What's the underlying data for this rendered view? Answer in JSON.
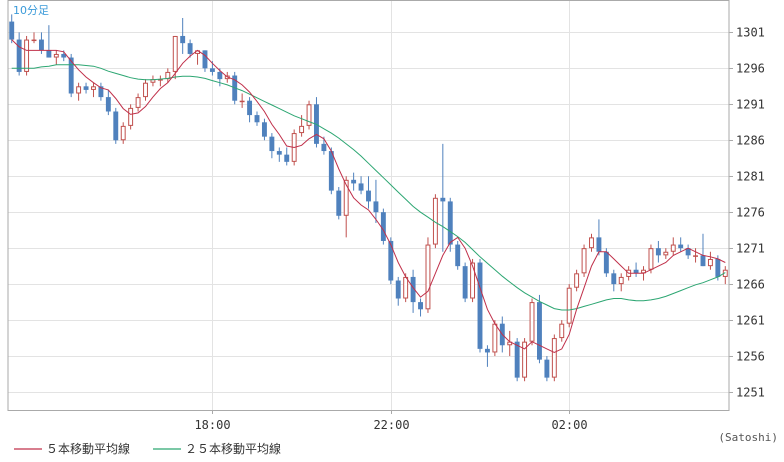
{
  "chart_data": {
    "type": "candlestick",
    "title": "10分足",
    "credit": "(Satoshi)",
    "y_ticks": [
      1301,
      1296,
      1291,
      1286,
      1281,
      1276,
      1271,
      1266,
      1261,
      1256,
      1251
    ],
    "ylim": [
      1248.5,
      1305.5
    ],
    "x_ticks": [
      {
        "label": "18:00",
        "index": 27
      },
      {
        "label": "22:00",
        "index": 51
      },
      {
        "label": "02:00",
        "index": 75
      }
    ],
    "x_count": 97,
    "grid": true,
    "colors": {
      "up": "#c0504d",
      "down": "#4f81bd",
      "ma5": "#c0304a",
      "ma25": "#2ca672",
      "grid": "#e3e3e3",
      "frame": "#aaaaaa",
      "title": "#3a9ad9"
    },
    "legend": [
      {
        "label": "５本移動平均線",
        "color": "#c0304a"
      },
      {
        "label": "２５本移動平均線",
        "color": "#2ca672"
      }
    ],
    "candles": [
      [
        1302.5,
        1303.5,
        1299.5,
        1300.0
      ],
      [
        1300.0,
        1301.0,
        1295.0,
        1295.5
      ],
      [
        1295.5,
        1300.5,
        1295.0,
        1300.0
      ],
      [
        1300.0,
        1301.0,
        1299.5,
        1300.0
      ],
      [
        1300.0,
        1301.0,
        1298.0,
        1298.5
      ],
      [
        1298.5,
        1302.0,
        1297.5,
        1297.5
      ],
      [
        1297.5,
        1298.5,
        1296.5,
        1298.0
      ],
      [
        1298.0,
        1298.5,
        1297.0,
        1297.5
      ],
      [
        1297.5,
        1298.0,
        1292.0,
        1292.5
      ],
      [
        1292.5,
        1294.0,
        1291.5,
        1293.5
      ],
      [
        1293.5,
        1294.0,
        1292.5,
        1293.0
      ],
      [
        1293.0,
        1294.0,
        1292.0,
        1293.5
      ],
      [
        1293.5,
        1294.0,
        1291.5,
        1292.0
      ],
      [
        1292.0,
        1293.0,
        1289.5,
        1290.0
      ],
      [
        1290.0,
        1290.5,
        1285.5,
        1286.0
      ],
      [
        1286.0,
        1288.5,
        1285.5,
        1288.0
      ],
      [
        1288.0,
        1291.0,
        1287.5,
        1290.5
      ],
      [
        1290.5,
        1292.5,
        1290.0,
        1292.0
      ],
      [
        1292.0,
        1294.5,
        1291.5,
        1294.0
      ],
      [
        1294.0,
        1295.0,
        1293.5,
        1294.5
      ],
      [
        1294.5,
        1295.0,
        1293.5,
        1294.5
      ],
      [
        1294.5,
        1296.0,
        1294.0,
        1295.5
      ],
      [
        1295.5,
        1300.5,
        1294.5,
        1300.5
      ],
      [
        1300.5,
        1303.0,
        1298.0,
        1299.5
      ],
      [
        1299.5,
        1300.0,
        1297.5,
        1298.0
      ],
      [
        1298.0,
        1298.5,
        1296.5,
        1298.5
      ],
      [
        1298.5,
        1298.5,
        1295.5,
        1296.0
      ],
      [
        1296.0,
        1297.0,
        1295.0,
        1295.5
      ],
      [
        1295.5,
        1296.0,
        1293.5,
        1294.5
      ],
      [
        1294.5,
        1295.5,
        1294.0,
        1295.0
      ],
      [
        1295.0,
        1295.5,
        1291.0,
        1291.5
      ],
      [
        1291.5,
        1292.5,
        1290.5,
        1291.5
      ],
      [
        1291.5,
        1292.0,
        1288.5,
        1289.5
      ],
      [
        1289.5,
        1290.0,
        1288.0,
        1288.5
      ],
      [
        1288.5,
        1289.0,
        1286.0,
        1286.5
      ],
      [
        1286.5,
        1287.0,
        1283.5,
        1284.5
      ],
      [
        1284.5,
        1285.0,
        1283.0,
        1284.0
      ],
      [
        1284.0,
        1285.0,
        1282.5,
        1283.0
      ],
      [
        1283.0,
        1287.5,
        1282.5,
        1287.0
      ],
      [
        1287.0,
        1289.5,
        1286.5,
        1288.0
      ],
      [
        1288.0,
        1291.5,
        1287.5,
        1291.0
      ],
      [
        1291.0,
        1292.0,
        1285.0,
        1285.5
      ],
      [
        1285.5,
        1286.5,
        1284.0,
        1284.5
      ],
      [
        1284.5,
        1285.0,
        1278.5,
        1279.0
      ],
      [
        1279.0,
        1279.5,
        1275.0,
        1275.5
      ],
      [
        1275.5,
        1281.0,
        1272.5,
        1280.5
      ],
      [
        1280.5,
        1281.5,
        1279.0,
        1280.0
      ],
      [
        1280.0,
        1281.0,
        1278.5,
        1279.0
      ],
      [
        1279.0,
        1281.0,
        1276.5,
        1277.5
      ],
      [
        1277.5,
        1280.5,
        1274.5,
        1276.0
      ],
      [
        1276.0,
        1276.5,
        1271.5,
        1272.0
      ],
      [
        1272.0,
        1272.5,
        1266.0,
        1266.5
      ],
      [
        1266.5,
        1267.0,
        1263.0,
        1264.0
      ],
      [
        1264.0,
        1267.5,
        1263.5,
        1267.0
      ],
      [
        1267.0,
        1268.0,
        1262.0,
        1263.5
      ],
      [
        1263.5,
        1264.0,
        1261.5,
        1262.5
      ],
      [
        1262.5,
        1272.5,
        1262.0,
        1271.5
      ],
      [
        1271.5,
        1278.5,
        1271.0,
        1278.0
      ],
      [
        1278.0,
        1285.5,
        1270.5,
        1277.5
      ],
      [
        1277.5,
        1278.0,
        1270.5,
        1271.5
      ],
      [
        1271.5,
        1272.0,
        1268.0,
        1268.5
      ],
      [
        1268.5,
        1269.0,
        1263.5,
        1264.0
      ],
      [
        1264.0,
        1269.5,
        1263.5,
        1269.0
      ],
      [
        1269.0,
        1269.5,
        1256.5,
        1257.0
      ],
      [
        1257.0,
        1257.5,
        1254.5,
        1256.5
      ],
      [
        1256.5,
        1261.0,
        1256.0,
        1260.5
      ],
      [
        1260.5,
        1261.5,
        1256.5,
        1257.5
      ],
      [
        1257.5,
        1259.5,
        1256.0,
        1258.0
      ],
      [
        1258.0,
        1258.5,
        1252.5,
        1253.0
      ],
      [
        1253.0,
        1258.5,
        1252.5,
        1258.0
      ],
      [
        1258.0,
        1264.0,
        1257.5,
        1263.5
      ],
      [
        1263.5,
        1264.5,
        1255.0,
        1255.5
      ],
      [
        1255.5,
        1256.0,
        1252.5,
        1253.0
      ],
      [
        1253.0,
        1259.0,
        1252.5,
        1258.5
      ],
      [
        1258.5,
        1261.0,
        1258.0,
        1260.5
      ],
      [
        1260.5,
        1266.0,
        1260.0,
        1265.5
      ],
      [
        1265.5,
        1268.0,
        1265.0,
        1267.5
      ],
      [
        1267.5,
        1271.5,
        1267.0,
        1271.0
      ],
      [
        1271.0,
        1273.0,
        1270.5,
        1272.5
      ],
      [
        1272.5,
        1275.0,
        1270.0,
        1270.5
      ],
      [
        1270.5,
        1271.0,
        1267.0,
        1267.5
      ],
      [
        1267.5,
        1268.0,
        1265.0,
        1266.0
      ],
      [
        1266.0,
        1267.5,
        1265.0,
        1267.0
      ],
      [
        1267.0,
        1268.5,
        1266.5,
        1268.0
      ],
      [
        1268.0,
        1269.0,
        1267.0,
        1267.5
      ],
      [
        1267.5,
        1268.5,
        1266.5,
        1268.0
      ],
      [
        1268.0,
        1271.5,
        1267.5,
        1271.0
      ],
      [
        1271.0,
        1272.0,
        1269.0,
        1270.0
      ],
      [
        1270.0,
        1271.0,
        1269.5,
        1270.5
      ],
      [
        1270.5,
        1272.5,
        1270.0,
        1271.5
      ],
      [
        1271.5,
        1272.5,
        1270.5,
        1271.0
      ],
      [
        1271.0,
        1271.5,
        1269.5,
        1270.0
      ],
      [
        1270.0,
        1271.0,
        1269.0,
        1270.0
      ],
      [
        1270.0,
        1273.0,
        1268.5,
        1268.5
      ],
      [
        1268.5,
        1270.5,
        1268.0,
        1269.5
      ],
      [
        1269.5,
        1270.0,
        1266.5,
        1267.0
      ],
      [
        1267.0,
        1268.5,
        1266.0,
        1268.0
      ]
    ],
    "ma5": [
      1300.0,
      1299.0,
      1298.5,
      1298.5,
      1298.5,
      1298.5,
      1298.5,
      1298.3,
      1297.0,
      1295.8,
      1294.8,
      1294.0,
      1293.3,
      1293.0,
      1291.8,
      1290.4,
      1289.6,
      1289.8,
      1290.7,
      1292.0,
      1293.2,
      1294.0,
      1295.3,
      1296.7,
      1297.7,
      1298.5,
      1297.8,
      1296.7,
      1295.7,
      1294.8,
      1294.4,
      1293.7,
      1292.7,
      1291.4,
      1290.0,
      1288.2,
      1286.8,
      1285.2,
      1285.0,
      1285.3,
      1286.2,
      1286.8,
      1286.2,
      1284.5,
      1282.0,
      1279.8,
      1278.0,
      1277.0,
      1276.3,
      1275.0,
      1273.5,
      1271.5,
      1269.0,
      1267.0,
      1265.5,
      1264.2,
      1265.0,
      1267.5,
      1270.0,
      1271.8,
      1272.5,
      1271.0,
      1268.5,
      1265.5,
      1262.5,
      1260.5,
      1259.0,
      1258.0,
      1257.5,
      1257.0,
      1258.0,
      1257.5,
      1257.0,
      1256.5,
      1257.0,
      1259.0,
      1262.5,
      1265.5,
      1268.5,
      1270.5,
      1270.5,
      1269.5,
      1268.5,
      1267.5,
      1267.5,
      1267.5,
      1268.0,
      1268.5,
      1269.0,
      1270.0,
      1270.5,
      1271.0,
      1270.5,
      1270.0,
      1269.8,
      1269.5,
      1269.0
    ],
    "ma25": [
      1296.0,
      1296.0,
      1296.0,
      1296.0,
      1296.2,
      1296.3,
      1296.5,
      1296.5,
      1296.5,
      1296.5,
      1296.4,
      1296.3,
      1296.0,
      1295.6,
      1295.3,
      1295.0,
      1294.7,
      1294.5,
      1294.4,
      1294.4,
      1294.5,
      1294.6,
      1294.8,
      1294.9,
      1294.9,
      1294.8,
      1294.6,
      1294.3,
      1294.0,
      1293.7,
      1293.3,
      1292.9,
      1292.4,
      1291.9,
      1291.4,
      1290.9,
      1290.4,
      1289.9,
      1289.4,
      1289.0,
      1288.6,
      1288.2,
      1287.6,
      1287.0,
      1286.3,
      1285.5,
      1284.7,
      1283.8,
      1282.8,
      1281.8,
      1280.8,
      1279.8,
      1278.8,
      1277.8,
      1276.8,
      1276.0,
      1275.3,
      1274.6,
      1274.0,
      1273.3,
      1272.6,
      1271.8,
      1270.8,
      1269.8,
      1268.9,
      1268.0,
      1267.1,
      1266.3,
      1265.5,
      1264.8,
      1264.2,
      1263.6,
      1263.1,
      1262.6,
      1262.4,
      1262.4,
      1262.6,
      1262.9,
      1263.2,
      1263.5,
      1263.8,
      1264.0,
      1264.0,
      1263.8,
      1263.7,
      1263.7,
      1263.8,
      1264.0,
      1264.3,
      1264.7,
      1265.1,
      1265.5,
      1265.9,
      1266.2,
      1266.6,
      1267.0,
      1267.6
    ]
  }
}
